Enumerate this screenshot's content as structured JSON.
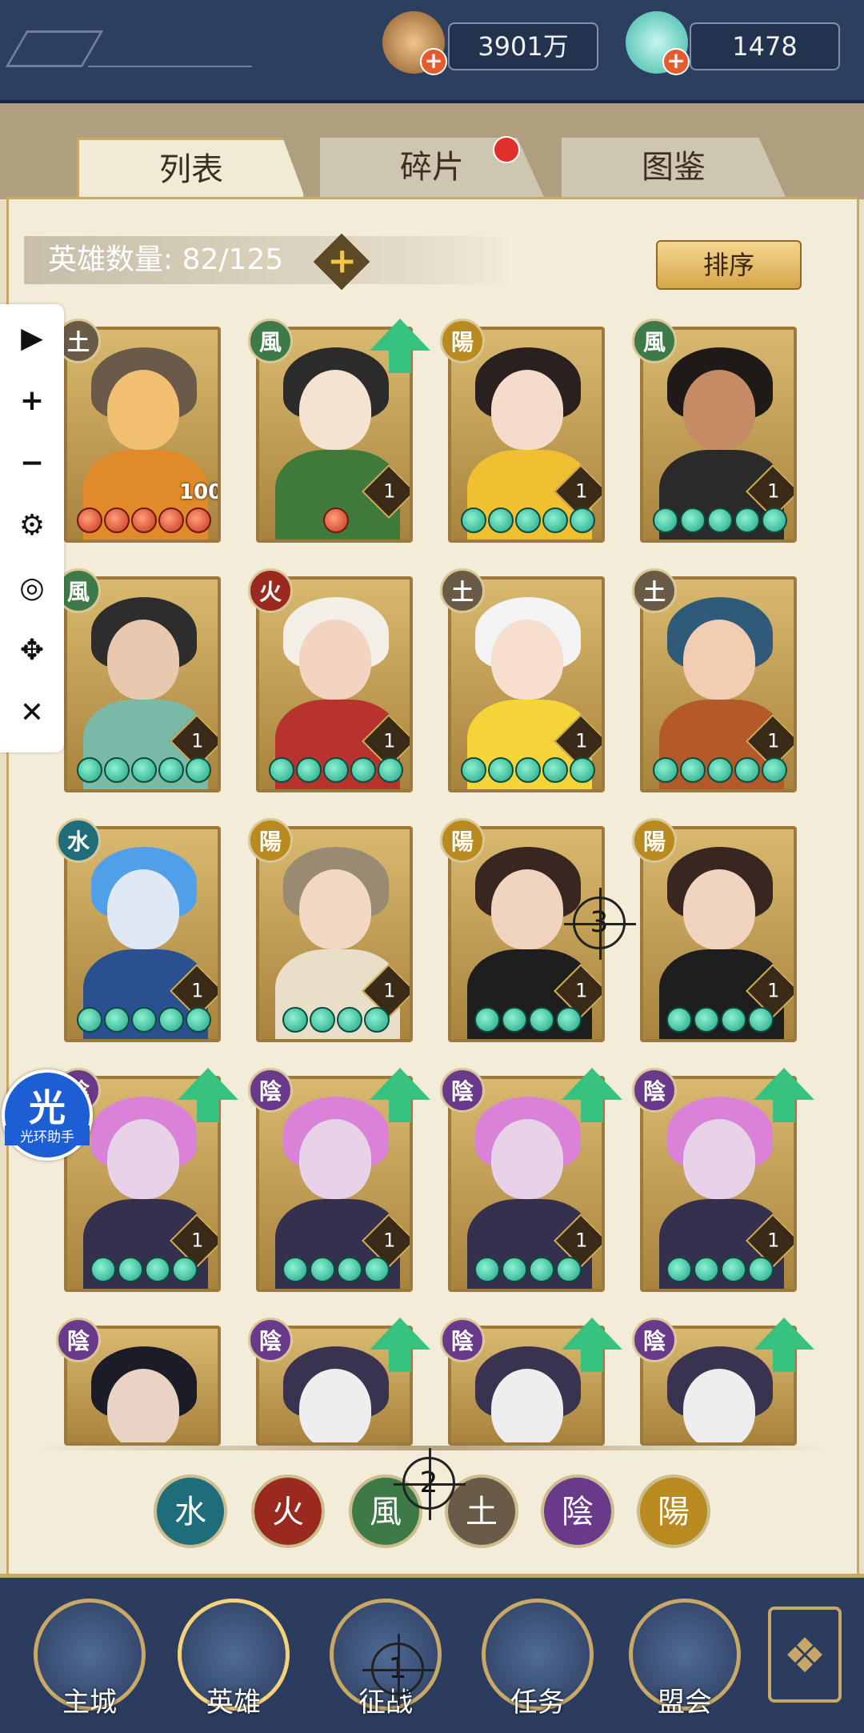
{
  "resources": {
    "coins": "3901万",
    "jade": "1478",
    "plus": "+"
  },
  "tabs": [
    "列表",
    "碎片",
    "图鉴"
  ],
  "hero_count_label": "英雄数量: 82/125",
  "count_plus": "+",
  "sort_label": "排序",
  "sidebar": [
    "play-icon",
    "plus-icon",
    "minus-icon",
    "gear-icon",
    "eye-off-icon",
    "move-icon",
    "close-icon"
  ],
  "sidebar_glyphs": [
    "▶",
    "+",
    "−",
    "⚙",
    "◎",
    "✥",
    "✕"
  ],
  "cards": [
    {
      "element": "土",
      "level": "100",
      "orbs": "rrrrr",
      "upgrade": false,
      "colors": [
        "#6b5a4a",
        "#e08a2a",
        "#f0c070"
      ]
    },
    {
      "element": "風",
      "level": "1",
      "orbs": "r",
      "upgrade": true,
      "colors": [
        "#2b2b2b",
        "#3f7a3a",
        "#f6e2d0"
      ]
    },
    {
      "element": "陽",
      "level": "1",
      "orbs": "ggggg",
      "upgrade": false,
      "colors": [
        "#2a2020",
        "#f0c030",
        "#f3dccc"
      ]
    },
    {
      "element": "風",
      "level": "1",
      "orbs": "ggggg",
      "upgrade": false,
      "colors": [
        "#1f1a18",
        "#2a2a2a",
        "#c58b64"
      ]
    },
    {
      "element": "風",
      "level": "1",
      "orbs": "ggggg",
      "upgrade": false,
      "colors": [
        "#2d2d2d",
        "#7ab8a8",
        "#e8c9b0"
      ]
    },
    {
      "element": "火",
      "level": "1",
      "orbs": "ggggg",
      "upgrade": false,
      "colors": [
        "#f3eee6",
        "#b8332e",
        "#f2d4c0"
      ]
    },
    {
      "element": "土",
      "level": "1",
      "orbs": "ggggg",
      "upgrade": false,
      "colors": [
        "#f3f3f3",
        "#f5d43a",
        "#f6dfcf"
      ]
    },
    {
      "element": "土",
      "level": "1",
      "orbs": "ggggg",
      "upgrade": false,
      "colors": [
        "#2f5a7a",
        "#b45a2a",
        "#f1cdb3"
      ]
    },
    {
      "element": "水",
      "level": "1",
      "orbs": "ggggg",
      "upgrade": false,
      "colors": [
        "#4fa0e8",
        "#2b5090",
        "#dfe8f5"
      ]
    },
    {
      "element": "陽",
      "level": "1",
      "orbs": "gggg",
      "upgrade": false,
      "colors": [
        "#9a8a72",
        "#e9dfc8",
        "#f2d7c2"
      ]
    },
    {
      "element": "陽",
      "level": "1",
      "orbs": "gggg",
      "upgrade": false,
      "colors": [
        "#3a2620",
        "#1e1e1e",
        "#f0d4c0"
      ]
    },
    {
      "element": "陽",
      "level": "1",
      "orbs": "gggg",
      "upgrade": false,
      "colors": [
        "#3a2620",
        "#1e1e1e",
        "#f0d4c0"
      ]
    },
    {
      "element": "陰",
      "level": "1",
      "orbs": "gggg",
      "upgrade": true,
      "colors": [
        "#d982d8",
        "#35304e",
        "#e8d2e8"
      ]
    },
    {
      "element": "陰",
      "level": "1",
      "orbs": "gggg",
      "upgrade": true,
      "colors": [
        "#d982d8",
        "#35304e",
        "#e8d2e8"
      ]
    },
    {
      "element": "陰",
      "level": "1",
      "orbs": "gggg",
      "upgrade": true,
      "colors": [
        "#d982d8",
        "#35304e",
        "#e8d2e8"
      ]
    },
    {
      "element": "陰",
      "level": "1",
      "orbs": "gggg",
      "upgrade": true,
      "colors": [
        "#d982d8",
        "#35304e",
        "#e8d2e8"
      ]
    },
    {
      "element": "陰",
      "level": "",
      "orbs": "",
      "upgrade": false,
      "colors": [
        "#1c1c28",
        "#c9a552",
        "#e9d3c4"
      ]
    },
    {
      "element": "陰",
      "level": "",
      "orbs": "",
      "upgrade": true,
      "colors": [
        "#3a3350",
        "#5a3aa0",
        "#eeeeee"
      ]
    },
    {
      "element": "陰",
      "level": "",
      "orbs": "",
      "upgrade": true,
      "colors": [
        "#3a3350",
        "#5a3aa0",
        "#eeeeee"
      ]
    },
    {
      "element": "陰",
      "level": "",
      "orbs": "",
      "upgrade": true,
      "colors": [
        "#3a3350",
        "#5a3aa0",
        "#eeeeee"
      ]
    }
  ],
  "element_colors": {
    "土": "#6a5a48",
    "風": "#3e7a48",
    "陽": "#b88a20",
    "火": "#9a2a20",
    "水": "#1f6d7a",
    "陰": "#6a3a8a"
  },
  "filters": [
    {
      "glyph": "水",
      "color": "#1f6d7a"
    },
    {
      "glyph": "火",
      "color": "#9a2a20"
    },
    {
      "glyph": "風",
      "color": "#3e7a48"
    },
    {
      "glyph": "土",
      "color": "#6a5a48"
    },
    {
      "glyph": "陰",
      "color": "#6a3a8a"
    },
    {
      "glyph": "陽",
      "color": "#b88a20"
    }
  ],
  "assistant": {
    "big": "光",
    "small": "光环助手"
  },
  "markers": [
    "1",
    "2",
    "3"
  ],
  "nav": [
    "主城",
    "英雄",
    "征战",
    "任务",
    "盟会"
  ],
  "nav_grid_glyph": "❖"
}
